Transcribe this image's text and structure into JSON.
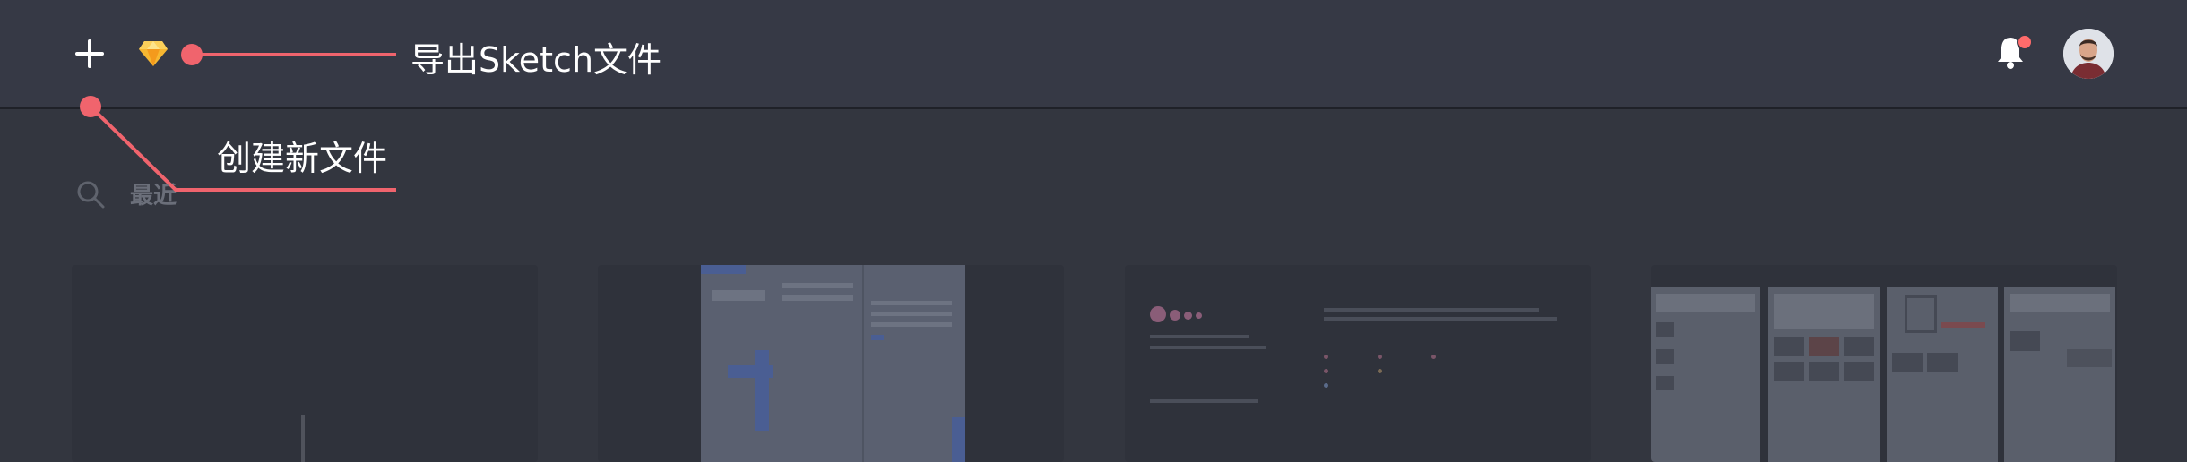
{
  "toolbar": {
    "add_icon": "plus-icon",
    "sketch_icon": "sketch-diamond-icon",
    "notification_icon": "bell-icon",
    "notification_badge_color": "#ff6b6b",
    "avatar": "user-avatar"
  },
  "recent": {
    "label": "最近",
    "icon": "search-icon"
  },
  "annotations": {
    "export_sketch": "导出Sketch文件",
    "create_new": "创建新文件",
    "accent": "#f0646d"
  },
  "files": [
    {
      "thumbnail": "blank-document"
    },
    {
      "thumbnail": "dashboard-form"
    },
    {
      "thumbnail": "profile-page"
    },
    {
      "thumbnail": "image-grid-pages"
    }
  ]
}
